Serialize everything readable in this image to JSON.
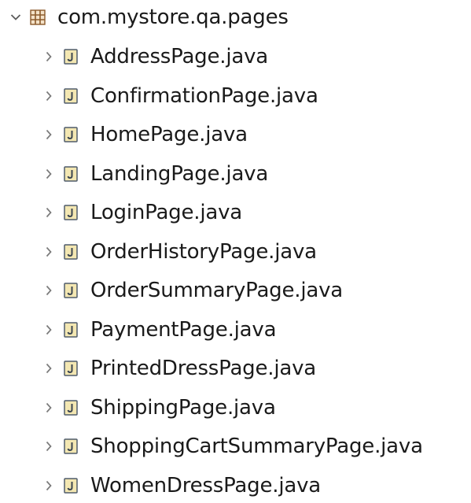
{
  "package": {
    "name": "com.mystore.qa.pages",
    "expanded": true,
    "icon": "package-icon"
  },
  "files": [
    {
      "label": "AddressPage.java"
    },
    {
      "label": "ConfirmationPage.java"
    },
    {
      "label": "HomePage.java"
    },
    {
      "label": "LandingPage.java"
    },
    {
      "label": "LoginPage.java"
    },
    {
      "label": "OrderHistoryPage.java"
    },
    {
      "label": "OrderSummaryPage.java"
    },
    {
      "label": "PaymentPage.java"
    },
    {
      "label": "PrintedDressPage.java"
    },
    {
      "label": "ShippingPage.java"
    },
    {
      "label": "ShoppingCartSummaryPage.java"
    },
    {
      "label": "WomenDressPage.java"
    }
  ],
  "colors": {
    "text": "#1a1a1a",
    "chevron": "#7a7a7a",
    "package_icon": "#8b5a2b",
    "java_icon_fill": "#f3e7b2",
    "java_icon_border": "#4f5c6b",
    "java_icon_letter": "#3c4650"
  }
}
